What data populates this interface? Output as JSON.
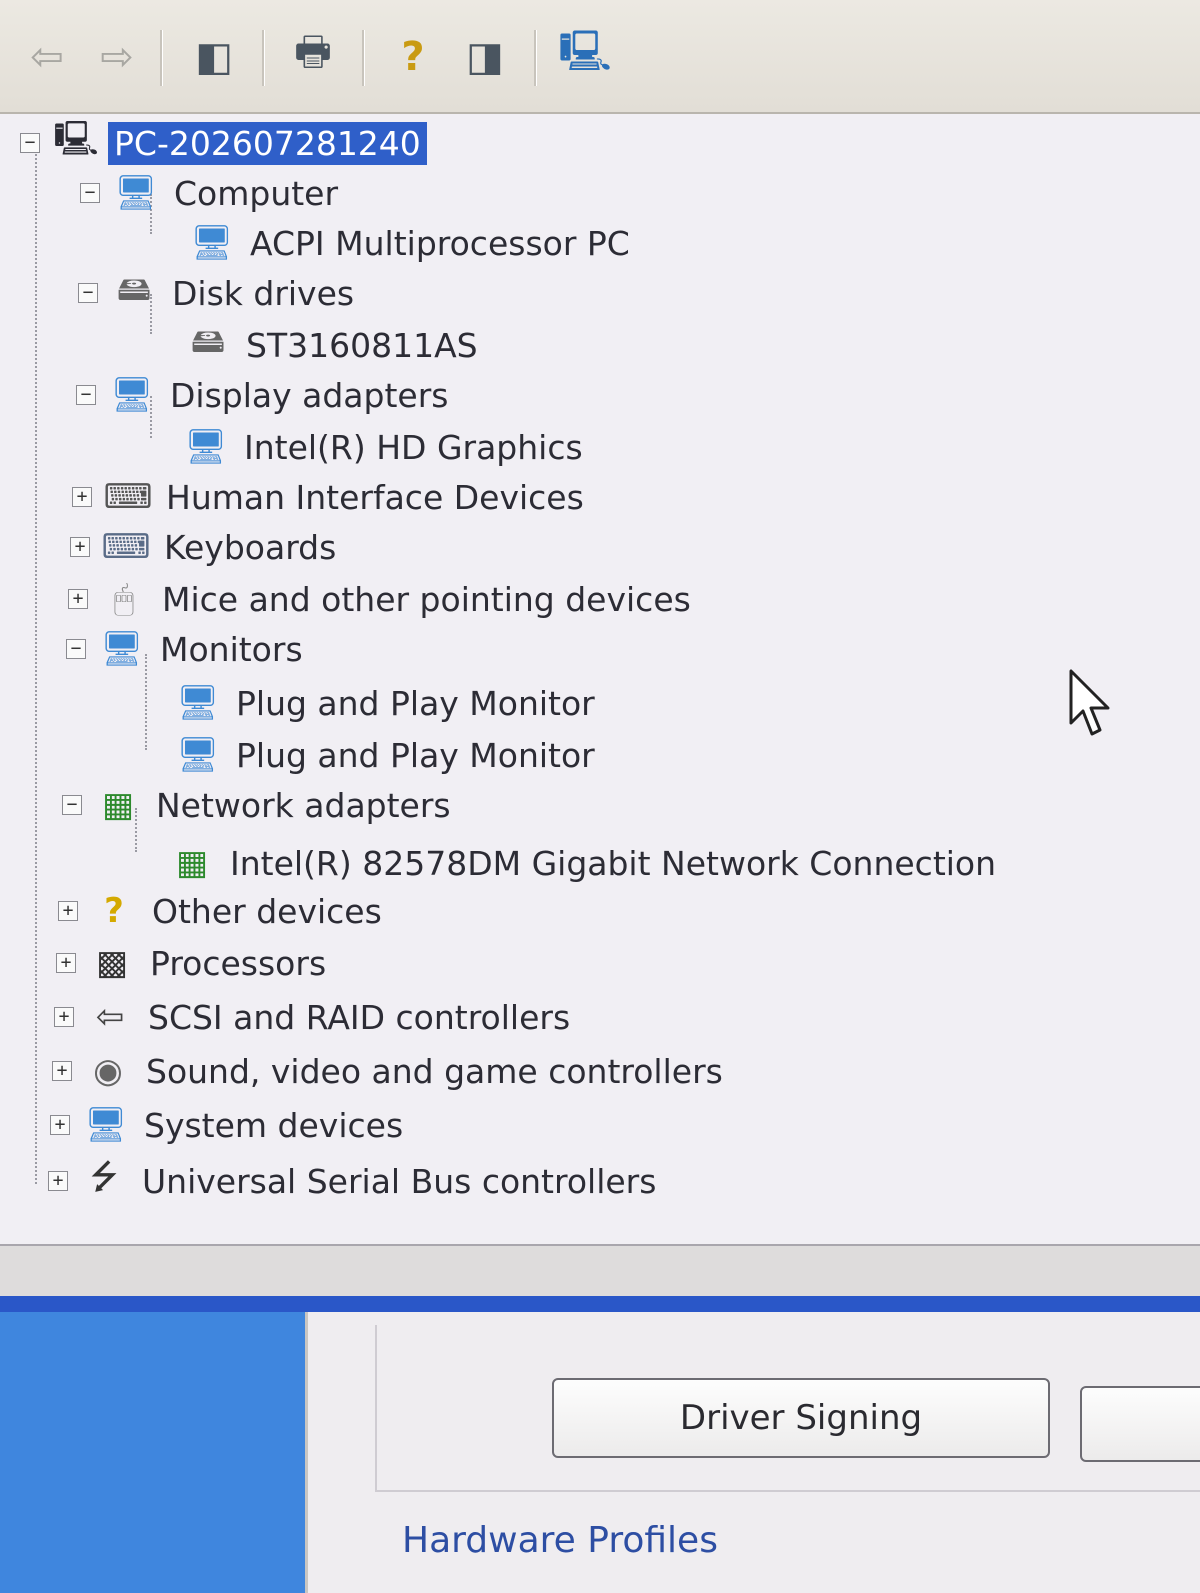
{
  "toolbar": {
    "buttons": [
      {
        "name": "back-button",
        "icon": "back-arrow-icon",
        "glyph": "⇦",
        "enabled": false
      },
      {
        "name": "forward-button",
        "icon": "forward-arrow-icon",
        "glyph": "⇨",
        "enabled": false
      },
      {
        "name": "show-hide-console-tree-button",
        "icon": "console-tree-icon",
        "glyph": "◧"
      },
      {
        "name": "print-button",
        "icon": "printer-icon",
        "glyph": "🖶"
      },
      {
        "name": "help-button",
        "icon": "help-icon",
        "glyph": "?"
      },
      {
        "name": "show-hide-action-pane-button",
        "icon": "action-pane-icon",
        "glyph": "◨"
      },
      {
        "name": "scan-hardware-button",
        "icon": "scan-hardware-icon",
        "glyph": "🖳"
      }
    ]
  },
  "tree": {
    "root": "PC-202607281240",
    "nodes": [
      {
        "label": "Computer",
        "expanded": true,
        "icon": "computer-icon",
        "children": [
          "ACPI Multiprocessor PC"
        ]
      },
      {
        "label": "Disk drives",
        "expanded": true,
        "icon": "disk-drive-icon",
        "children": [
          "ST3160811AS"
        ]
      },
      {
        "label": "Display adapters",
        "expanded": true,
        "icon": "display-adapter-icon",
        "children": [
          "Intel(R) HD Graphics"
        ]
      },
      {
        "label": "Human Interface Devices",
        "expanded": false,
        "icon": "hid-icon"
      },
      {
        "label": "Keyboards",
        "expanded": false,
        "icon": "keyboard-icon"
      },
      {
        "label": "Mice and other pointing devices",
        "expanded": false,
        "icon": "mouse-icon"
      },
      {
        "label": "Monitors",
        "expanded": true,
        "icon": "monitor-icon",
        "children": [
          "Plug and Play Monitor",
          "Plug and Play Monitor"
        ]
      },
      {
        "label": "Network adapters",
        "expanded": true,
        "icon": "network-adapter-icon",
        "children": [
          "Intel(R) 82578DM Gigabit Network Connection"
        ]
      },
      {
        "label": "Other devices",
        "expanded": false,
        "icon": "unknown-device-icon"
      },
      {
        "label": "Processors",
        "expanded": false,
        "icon": "processor-icon"
      },
      {
        "label": "SCSI and RAID controllers",
        "expanded": false,
        "icon": "scsi-controller-icon"
      },
      {
        "label": "Sound, video and game controllers",
        "expanded": false,
        "icon": "sound-icon"
      },
      {
        "label": "System devices",
        "expanded": false,
        "icon": "system-device-icon"
      },
      {
        "label": "Universal Serial Bus controllers",
        "expanded": false,
        "icon": "usb-icon"
      }
    ],
    "expand_glyph": "+",
    "collapse_glyph": "−"
  },
  "dialog": {
    "driver_signing_label": "Driver Signing",
    "next_button_label": "",
    "hardware_profiles_label": "Hardware Profiles"
  },
  "colors": {
    "selection": "#2f5fc9",
    "accent_blue": "#2a57c8",
    "sidebar_blue": "#3f86de"
  }
}
